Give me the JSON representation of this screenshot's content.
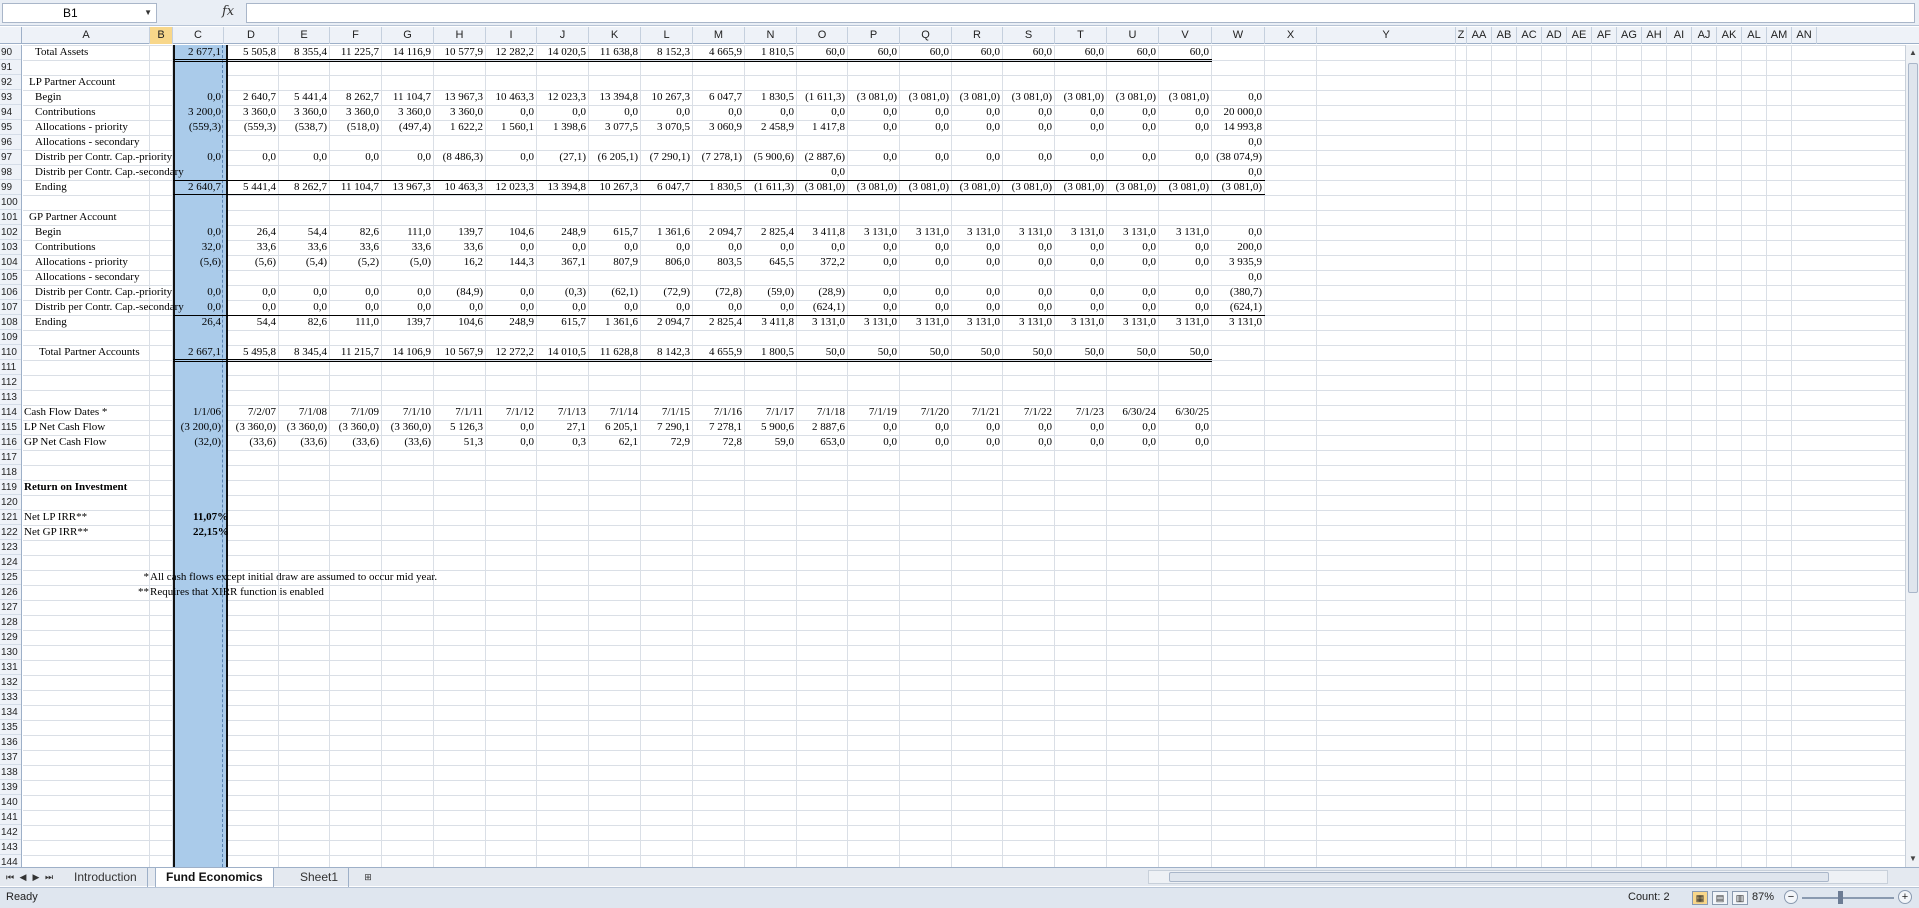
{
  "formula_bar": {
    "name_box": "B1",
    "fx_label": "fx",
    "formula": ""
  },
  "columns": [
    "A",
    "B",
    "C",
    "D",
    "E",
    "F",
    "G",
    "H",
    "I",
    "J",
    "K",
    "L",
    "M",
    "N",
    "O",
    "P",
    "Q",
    "R",
    "S",
    "T",
    "U",
    "V",
    "W",
    "X",
    "Y",
    "Z",
    "AA",
    "AB",
    "AC",
    "AD",
    "AE",
    "AF",
    "AG",
    "AH",
    "AI",
    "AJ",
    "AK",
    "AL",
    "AM",
    "AN"
  ],
  "selected_column": "B",
  "rows": [
    90,
    91,
    92,
    93,
    94,
    95,
    96,
    97,
    98,
    99,
    100,
    101,
    102,
    103,
    104,
    105,
    106,
    107,
    108,
    109,
    110,
    111,
    112,
    113,
    114,
    115,
    116,
    117,
    118,
    119,
    120,
    121,
    122,
    123,
    124,
    125,
    126,
    127,
    128,
    129,
    130,
    131,
    132,
    133,
    134,
    135,
    136,
    137,
    138,
    139,
    140,
    141,
    142,
    143,
    144
  ],
  "labels": {
    "r90": "Total Assets",
    "r92": "LP Partner Account",
    "r93": "Begin",
    "r94": "Contributions",
    "r95": "Allocations - priority",
    "r96": "Allocations - secondary",
    "r97": "Distrib per Contr. Cap.-priority",
    "r98": "Distrib per Contr. Cap.-secondary",
    "r99": "Ending",
    "r101": "GP Partner Account",
    "r102": "Begin",
    "r103": "Contributions",
    "r104": "Allocations - priority",
    "r105": "Allocations - secondary",
    "r106": "Distrib per Contr. Cap.-priority",
    "r107": "Distrib per Contr. Cap.-secondary",
    "r108": "Ending",
    "r110": "Total Partner Accounts",
    "r114": "Cash Flow Dates *",
    "r115": "LP Net Cash Flow",
    "r116": "GP Net Cash Flow",
    "r119": "Return on Investment",
    "r121": "Net  LP IRR**",
    "r122": "Net GP IRR**"
  },
  "table": {
    "r90": [
      "2 677,1",
      "5 505,8",
      "8 355,4",
      "11 225,7",
      "14 116,9",
      "10 577,9",
      "12 282,2",
      "14 020,5",
      "11 638,8",
      "8 152,3",
      "4 665,9",
      "1 810,5",
      "60,0",
      "60,0",
      "60,0",
      "60,0",
      "60,0",
      "60,0",
      "60,0",
      "60,0",
      ""
    ],
    "r93": [
      "0,0",
      "2 640,7",
      "5 441,4",
      "8 262,7",
      "11 104,7",
      "13 967,3",
      "10 463,3",
      "12 023,3",
      "13 394,8",
      "10 267,3",
      "6 047,7",
      "1 830,5",
      "(1 611,3)",
      "(3 081,0)",
      "(3 081,0)",
      "(3 081,0)",
      "(3 081,0)",
      "(3 081,0)",
      "(3 081,0)",
      "(3 081,0)",
      "0,0"
    ],
    "r94": [
      "3 200,0",
      "3 360,0",
      "3 360,0",
      "3 360,0",
      "3 360,0",
      "3 360,0",
      "0,0",
      "0,0",
      "0,0",
      "0,0",
      "0,0",
      "0,0",
      "0,0",
      "0,0",
      "0,0",
      "0,0",
      "0,0",
      "0,0",
      "0,0",
      "0,0",
      "20 000,0"
    ],
    "r95": [
      "(559,3)",
      "(559,3)",
      "(538,7)",
      "(518,0)",
      "(497,4)",
      "1 622,2",
      "1 560,1",
      "1 398,6",
      "3 077,5",
      "3 070,5",
      "3 060,9",
      "2 458,9",
      "1 417,8",
      "0,0",
      "0,0",
      "0,0",
      "0,0",
      "0,0",
      "0,0",
      "0,0",
      "14 993,8"
    ],
    "r96": [
      "",
      "",
      "",
      "",
      "",
      "",
      "",
      "",
      "",
      "",
      "",
      "",
      "",
      "",
      "",
      "",
      "",
      "",
      "",
      "",
      "0,0"
    ],
    "r97": [
      "0,0",
      "0,0",
      "0,0",
      "0,0",
      "0,0",
      "(8 486,3)",
      "0,0",
      "(27,1)",
      "(6 205,1)",
      "(7 290,1)",
      "(7 278,1)",
      "(5 900,6)",
      "(2 887,6)",
      "0,0",
      "0,0",
      "0,0",
      "0,0",
      "0,0",
      "0,0",
      "0,0",
      "(38 074,9)"
    ],
    "r98": [
      "",
      "",
      "",
      "",
      "",
      "",
      "",
      "",
      "",
      "",
      "",
      "",
      "0,0",
      "",
      "",
      "",
      "",
      "",
      "",
      "",
      "0,0"
    ],
    "r99": [
      "2 640,7",
      "5 441,4",
      "8 262,7",
      "11 104,7",
      "13 967,3",
      "10 463,3",
      "12 023,3",
      "13 394,8",
      "10 267,3",
      "6 047,7",
      "1 830,5",
      "(1 611,3)",
      "(3 081,0)",
      "(3 081,0)",
      "(3 081,0)",
      "(3 081,0)",
      "(3 081,0)",
      "(3 081,0)",
      "(3 081,0)",
      "(3 081,0)",
      "(3 081,0)"
    ],
    "r102": [
      "0,0",
      "26,4",
      "54,4",
      "82,6",
      "111,0",
      "139,7",
      "104,6",
      "248,9",
      "615,7",
      "1 361,6",
      "2 094,7",
      "2 825,4",
      "3 411,8",
      "3 131,0",
      "3 131,0",
      "3 131,0",
      "3 131,0",
      "3 131,0",
      "3 131,0",
      "3 131,0",
      "0,0"
    ],
    "r103": [
      "32,0",
      "33,6",
      "33,6",
      "33,6",
      "33,6",
      "33,6",
      "0,0",
      "0,0",
      "0,0",
      "0,0",
      "0,0",
      "0,0",
      "0,0",
      "0,0",
      "0,0",
      "0,0",
      "0,0",
      "0,0",
      "0,0",
      "0,0",
      "200,0"
    ],
    "r104": [
      "(5,6)",
      "(5,6)",
      "(5,4)",
      "(5,2)",
      "(5,0)",
      "16,2",
      "144,3",
      "367,1",
      "807,9",
      "806,0",
      "803,5",
      "645,5",
      "372,2",
      "0,0",
      "0,0",
      "0,0",
      "0,0",
      "0,0",
      "0,0",
      "0,0",
      "3 935,9"
    ],
    "r105": [
      "",
      "",
      "",
      "",
      "",
      "",
      "",
      "",
      "",
      "",
      "",
      "",
      "",
      "",
      "",
      "",
      "",
      "",
      "",
      "",
      "0,0"
    ],
    "r106": [
      "0,0",
      "0,0",
      "0,0",
      "0,0",
      "0,0",
      "(84,9)",
      "0,0",
      "(0,3)",
      "(62,1)",
      "(72,9)",
      "(72,8)",
      "(59,0)",
      "(28,9)",
      "0,0",
      "0,0",
      "0,0",
      "0,0",
      "0,0",
      "0,0",
      "0,0",
      "(380,7)"
    ],
    "r107": [
      "0,0",
      "0,0",
      "0,0",
      "0,0",
      "0,0",
      "0,0",
      "0,0",
      "0,0",
      "0,0",
      "0,0",
      "0,0",
      "0,0",
      "(624,1)",
      "0,0",
      "0,0",
      "0,0",
      "0,0",
      "0,0",
      "0,0",
      "0,0",
      "(624,1)"
    ],
    "r108": [
      "26,4",
      "54,4",
      "82,6",
      "111,0",
      "139,7",
      "104,6",
      "248,9",
      "615,7",
      "1 361,6",
      "2 094,7",
      "2 825,4",
      "3 411,8",
      "3 131,0",
      "3 131,0",
      "3 131,0",
      "3 131,0",
      "3 131,0",
      "3 131,0",
      "3 131,0",
      "3 131,0",
      "3 131,0"
    ],
    "r110": [
      "2 667,1",
      "5 495,8",
      "8 345,4",
      "11 215,7",
      "14 106,9",
      "10 567,9",
      "12 272,2",
      "14 010,5",
      "11 628,8",
      "8 142,3",
      "4 655,9",
      "1 800,5",
      "50,0",
      "50,0",
      "50,0",
      "50,0",
      "50,0",
      "50,0",
      "50,0",
      "50,0",
      ""
    ],
    "r114": [
      "1/1/06",
      "7/2/07",
      "7/1/08",
      "7/1/09",
      "7/1/10",
      "7/1/11",
      "7/1/12",
      "7/1/13",
      "7/1/14",
      "7/1/15",
      "7/1/16",
      "7/1/17",
      "7/1/18",
      "7/1/19",
      "7/1/20",
      "7/1/21",
      "7/1/22",
      "7/1/23",
      "6/30/24",
      "6/30/25",
      ""
    ],
    "r115": [
      "(3 200,0)",
      "(3 360,0)",
      "(3 360,0)",
      "(3 360,0)",
      "(3 360,0)",
      "5 126,3",
      "0,0",
      "27,1",
      "6 205,1",
      "7 290,1",
      "7 278,1",
      "5 900,6",
      "2 887,6",
      "0,0",
      "0,0",
      "0,0",
      "0,0",
      "0,0",
      "0,0",
      "0,0",
      ""
    ],
    "r116": [
      "(32,0)",
      "(33,6)",
      "(33,6)",
      "(33,6)",
      "(33,6)",
      "51,3",
      "0,0",
      "0,3",
      "62,1",
      "72,9",
      "72,8",
      "59,0",
      "653,0",
      "0,0",
      "0,0",
      "0,0",
      "0,0",
      "0,0",
      "0,0",
      "0,0",
      ""
    ]
  },
  "irr": {
    "lp": "11,07%",
    "gp": "22,15%"
  },
  "notes": {
    "n1_marker": "*",
    "n1_text": "All cash flows except initial draw are assumed to occur mid year.",
    "n2_marker": "**",
    "n2_text": "Requires that XIRR function is enabled"
  },
  "sheet_tabs": [
    "Introduction",
    "Fund Economics",
    "Sheet1"
  ],
  "active_tab": "Fund Economics",
  "status": {
    "ready": "Ready",
    "count": "Count: 2",
    "zoom": "87%"
  },
  "colors": {
    "selection_fill": "#aacbea",
    "header_selected": "#f8d78a",
    "grid_line": "#dadfe6"
  }
}
